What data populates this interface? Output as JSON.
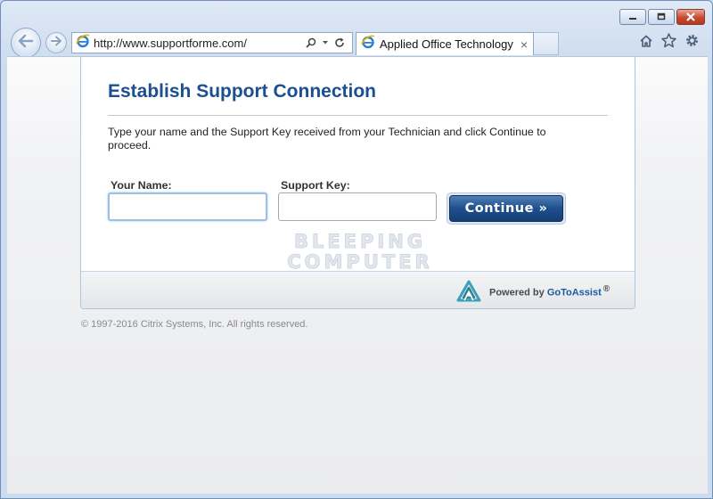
{
  "browser": {
    "address": "http://www.supportforme.com/",
    "tab_title": "Applied Office Technology...",
    "tab_close": "×"
  },
  "page": {
    "title": "Establish Support Connection",
    "instructions": "Type your name and the Support Key received from your Technician and click Continue to proceed.",
    "name_label": "Your Name:",
    "name_value": "",
    "key_label": "Support Key:",
    "key_value": "",
    "continue_label": "Continue »",
    "watermark_line1": "BLEEPING",
    "watermark_line2": "COMPUTER",
    "powered_by": "Powered by",
    "brand": "GoToAssist",
    "registered": "®",
    "copyright": "© 1997-2016 Citrix Systems, Inc. All rights reserved."
  },
  "icons": {
    "back": "back-arrow-icon",
    "forward": "forward-arrow-icon",
    "ie": "ie-logo-icon",
    "search": "search-icon",
    "refresh": "refresh-icon",
    "home": "home-icon",
    "favorites": "star-icon",
    "tools": "gear-icon",
    "gotoassist": "gotoassist-logo-icon"
  },
  "colors": {
    "title": "#1b4f91",
    "button": "#1f4f8c",
    "brand": "#1b5a9e",
    "close_button": "#c44a32"
  }
}
